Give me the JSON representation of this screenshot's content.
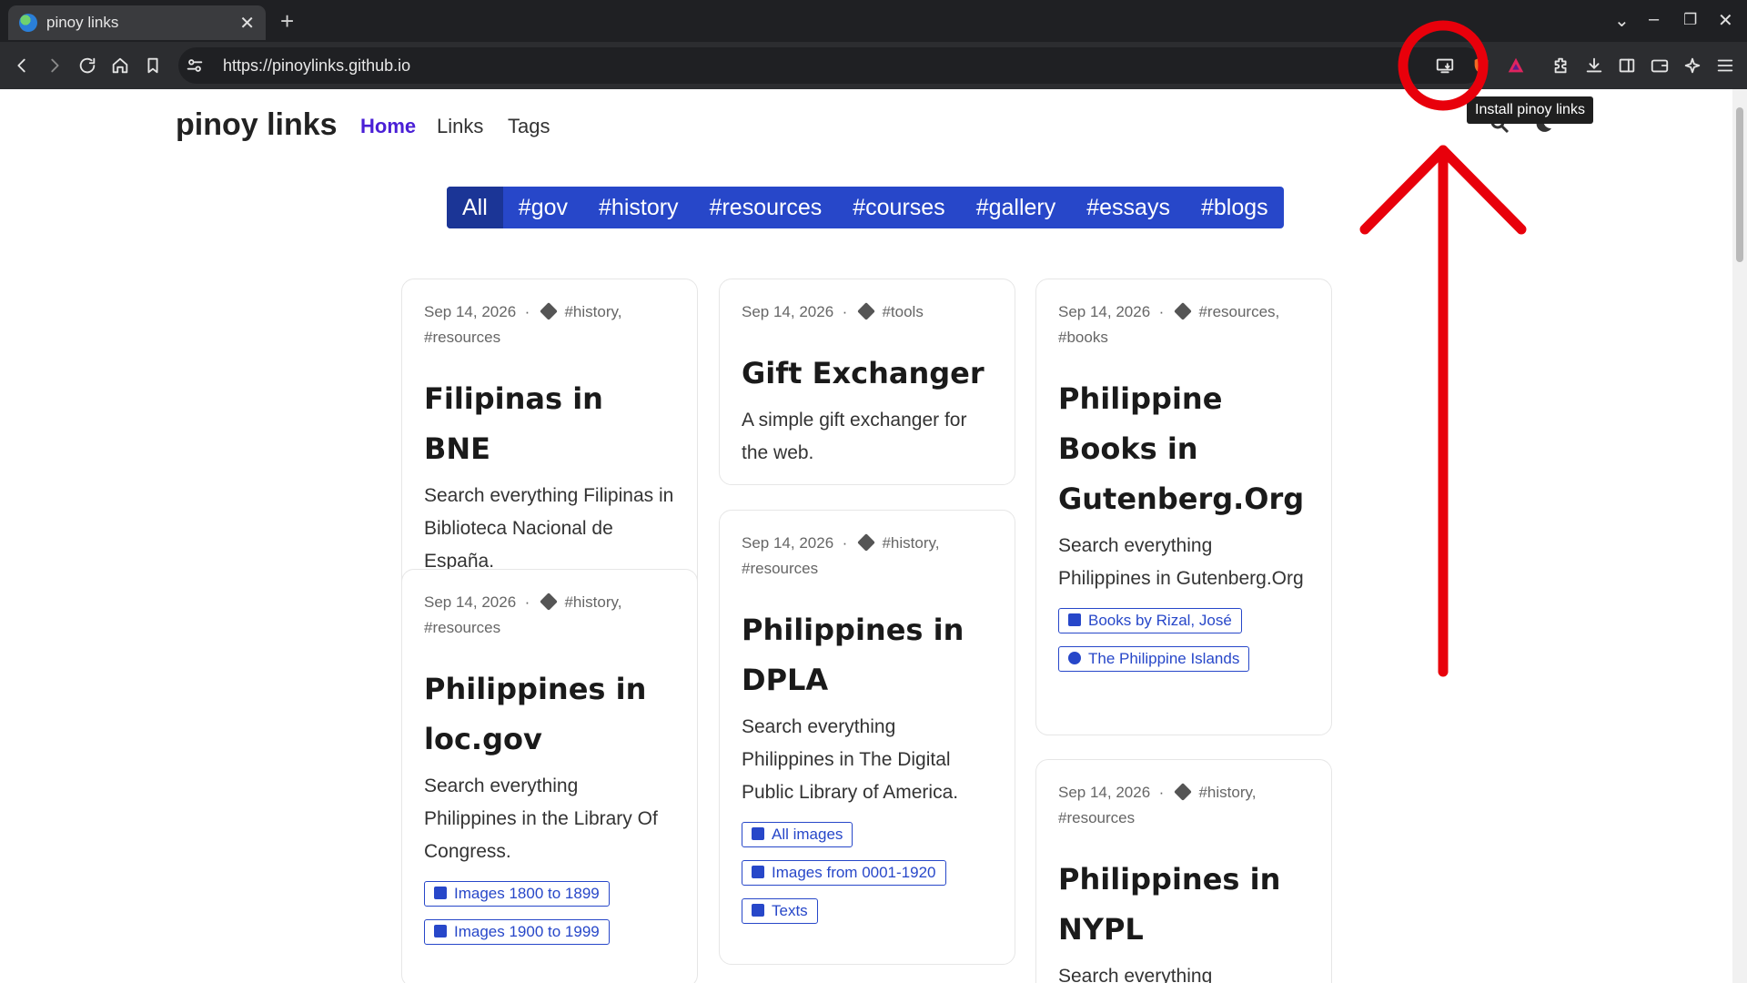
{
  "browser": {
    "tab_title": "pinoy links",
    "url": "https://pinoylinks.github.io",
    "tooltip": "Install pinoy links"
  },
  "site": {
    "title": "pinoy links",
    "nav": [
      "Home",
      "Links",
      "Tags"
    ]
  },
  "filters": [
    "All",
    "#gov",
    "#history",
    "#resources",
    "#courses",
    "#gallery",
    "#essays",
    "#blogs"
  ],
  "cards": {
    "c1": {
      "date": "Sep 14, 2026",
      "tags": "#history, #resources",
      "title": "Filipinas in BNE",
      "desc": "Search everything Filipinas in Biblioteca Nacional de España."
    },
    "c2": {
      "date": "Sep 14, 2026",
      "tags": "#history, #resources",
      "title": "Philippines in loc.gov",
      "desc": "Search everything Philippines in the Library Of Congress.",
      "links": [
        "Images 1800 to 1899",
        "Images 1900 to 1999"
      ]
    },
    "c3": {
      "date": "Sep 14, 2026",
      "tags": "#tools",
      "title": "Gift Exchanger",
      "desc": "A simple gift exchanger for the web."
    },
    "c4": {
      "date": "Sep 14, 2026",
      "tags": "#history, #resources",
      "title": "Philippines in DPLA",
      "desc": "Search everything Philippines in The Digital Public Library of America.",
      "links": [
        "All images",
        "Images from 0001-1920",
        "Texts"
      ]
    },
    "c5": {
      "date": "Sep 14, 2026",
      "tags": "#resources, #books",
      "title": "Philippine Books in Gutenberg.Org",
      "desc": "Search everything Philippines in Gutenberg.Org",
      "links": [
        "Books by Rizal, José",
        "The Philippine Islands"
      ]
    },
    "c6": {
      "date": "Sep 14, 2026",
      "tags": "#history, #resources",
      "title": "Philippines in NYPL",
      "desc": "Search everything"
    }
  },
  "colors": {
    "accent": "#2747c9",
    "nav_active": "#4a1fd6",
    "annotation": "#e8000b"
  }
}
